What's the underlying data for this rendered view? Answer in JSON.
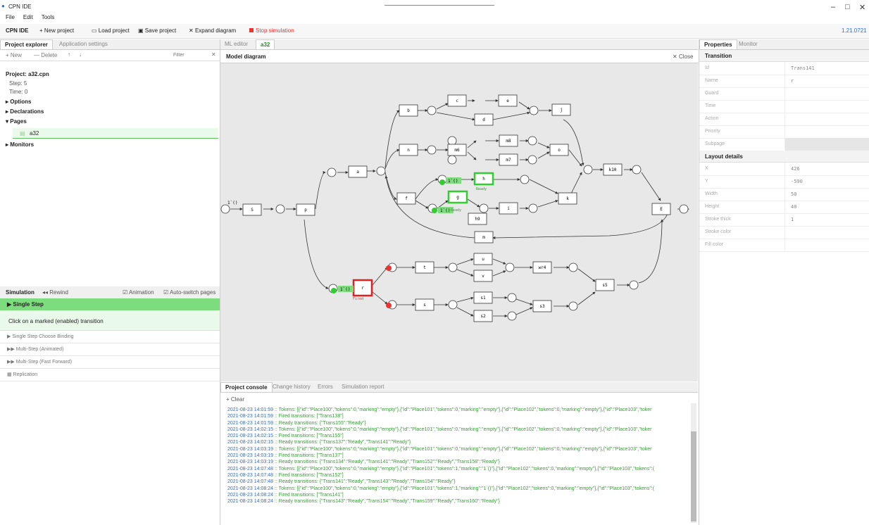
{
  "app": {
    "title": "CPN IDE"
  },
  "menu": [
    "File",
    "Edit",
    "Tools"
  ],
  "toolbar": {
    "brand": "CPN IDE",
    "new_project": "+ New project",
    "load_project": "Load project",
    "save_project": "Save project",
    "expand_diagram": "Expand diagram",
    "stop_simulation": "Stop simulation",
    "version": "1.21.0721"
  },
  "left": {
    "tabs": [
      "Project explorer",
      "Application settings"
    ],
    "pe_toolbar": {
      "new": "+ New",
      "delete": "— Delete",
      "filter_placeholder": "Filter"
    },
    "project": {
      "title": "Project: a32.cpn",
      "step": "Step: 5",
      "time": "Time: 0",
      "options": "Options",
      "declarations": "Declarations",
      "pages": "Pages",
      "page": "a32",
      "monitors": "Monitors"
    }
  },
  "simulation": {
    "header": "Simulation",
    "rewind": "Rewind",
    "animation": "Animation",
    "auto_switch": "Auto-switch pages",
    "single_step": "Single Step",
    "hint": "Click on a marked (enabled) transition",
    "items": [
      "Single Step Choose Binding",
      "Multi-Step (Animated)",
      "Multi-Step (Fast Forward)",
      "Replication"
    ]
  },
  "center": {
    "tabs": [
      "ML editor",
      "a32"
    ],
    "diagram_title": "Model diagram",
    "close": "Close",
    "console_tabs": [
      "Project console",
      "Change history",
      "Errors",
      "Simulation report"
    ],
    "clear": "+ Clear",
    "log": [
      {
        "ts": "2021-08-23 14:01:59",
        "msg": " :: Tokens: [{\"id\":\"Place100\",\"tokens\":0,\"marking\":\"empty\"},{\"id\":\"Place101\",\"tokens\":0,\"marking\":\"empty\"},{\"id\":\"Place102\",\"tokens\":0,\"marking\":\"empty\"},{\"id\":\"Place103\",\"toker"
      },
      {
        "ts": "2021-08-23 14:01:59",
        "msg": " :: Fired transitions: [\"Trans138\"]"
      },
      {
        "ts": "2021-08-23 14:01:59",
        "msg": " :: Ready transitions: {\"Trans155\":\"Ready\"}"
      },
      {
        "ts": "2021-08-23 14:02:15",
        "msg": " :: Tokens: [{\"id\":\"Place100\",\"tokens\":0,\"marking\":\"empty\"},{\"id\":\"Place101\",\"tokens\":0,\"marking\":\"empty\"},{\"id\":\"Place102\",\"tokens\":0,\"marking\":\"empty\"},{\"id\":\"Place103\",\"toker"
      },
      {
        "ts": "2021-08-23 14:02:15",
        "msg": " :: Fired transitions: [\"Trans155\"]"
      },
      {
        "ts": "2021-08-23 14:02:15",
        "msg": " :: Ready transitions: {\"Trans137\":\"Ready\",\"Trans141\":\"Ready\"}"
      },
      {
        "ts": "2021-08-23 14:03:19",
        "msg": " :: Tokens: [{\"id\":\"Place100\",\"tokens\":0,\"marking\":\"empty\"},{\"id\":\"Place101\",\"tokens\":0,\"marking\":\"empty\"},{\"id\":\"Place102\",\"tokens\":0,\"marking\":\"empty\"},{\"id\":\"Place103\",\"toker"
      },
      {
        "ts": "2021-08-23 14:03:19",
        "msg": " :: Fired transitions: [\"Trans137\"]"
      },
      {
        "ts": "2021-08-23 14:03:19",
        "msg": " :: Ready transitions: {\"Trans134\":\"Ready\",\"Trans141\":\"Ready\",\"Trans152\":\"Ready\",\"Trans158\":\"Ready\"}"
      },
      {
        "ts": "2021-08-23 14:07:48",
        "msg": " :: Tokens: [{\"id\":\"Place100\",\"tokens\":0,\"marking\":\"empty\"},{\"id\":\"Place101\",\"tokens\":1,\"marking\":\"1`()\"},{\"id\":\"Place102\",\"tokens\":0,\"marking\":\"empty\"},{\"id\":\"Place103\",\"tokens\":("
      },
      {
        "ts": "2021-08-23 14:07:48",
        "msg": " :: Fired transitions: [\"Trans152\"]"
      },
      {
        "ts": "2021-08-23 14:07:48",
        "msg": " :: Ready transitions: {\"Trans141\":\"Ready\",\"Trans143\":\"Ready\",\"Trans154\":\"Ready\"}"
      },
      {
        "ts": "2021-08-23 14:08:24",
        "msg": " :: Tokens: [{\"id\":\"Place100\",\"tokens\":0,\"marking\":\"empty\"},{\"id\":\"Place101\",\"tokens\":1,\"marking\":\"1`()\"},{\"id\":\"Place102\",\"tokens\":0,\"marking\":\"empty\"},{\"id\":\"Place103\",\"tokens\":("
      },
      {
        "ts": "2021-08-23 14:08:24",
        "msg": " :: Fired transitions: [\"Trans141\"]"
      },
      {
        "ts": "2021-08-23 14:08:24",
        "msg": " :: Ready transitions: {\"Trans143\":\"Ready\",\"Trans154\":\"Ready\",\"Trans159\":\"Ready\",\"Trans160\":\"Ready\"}"
      }
    ]
  },
  "diagram": {
    "tokens": {
      "start": "1`()",
      "g_token": "1`()",
      "g2": "1`()",
      "bottom": "1`()"
    },
    "labels": {
      "ready": "Ready",
      "ready2": "Ready",
      "fired": "Fired"
    },
    "transitions": [
      "S",
      "p",
      "a",
      "b",
      "c",
      "e",
      "d",
      "j",
      "n",
      "m6",
      "m8",
      "m7",
      "o",
      "h",
      "f",
      "g",
      "i",
      "h9",
      "k",
      "k10",
      "E",
      "m",
      "t",
      "u",
      "v",
      "wr4",
      "s",
      "s1",
      "s2",
      "s3",
      "s5",
      "r"
    ]
  },
  "properties": {
    "tabs": [
      "Properties",
      "Monitor"
    ],
    "section": "Transition",
    "rows": [
      {
        "k": "Id",
        "v": "Trans141"
      },
      {
        "k": "Name",
        "v": "r"
      },
      {
        "k": "Guard",
        "v": ""
      },
      {
        "k": "Time",
        "v": ""
      },
      {
        "k": "Action",
        "v": ""
      },
      {
        "k": "Priority",
        "v": ""
      },
      {
        "k": "Subpage",
        "v": ""
      }
    ],
    "layout_title": "Layout details",
    "layout": [
      {
        "k": "X",
        "v": "426"
      },
      {
        "k": "Y",
        "v": "-590"
      },
      {
        "k": "Width",
        "v": "50"
      },
      {
        "k": "Height",
        "v": "40"
      },
      {
        "k": "Stroke thick",
        "v": "1"
      },
      {
        "k": "Stroke color",
        "v": ""
      },
      {
        "k": "Fill color",
        "v": ""
      }
    ]
  }
}
